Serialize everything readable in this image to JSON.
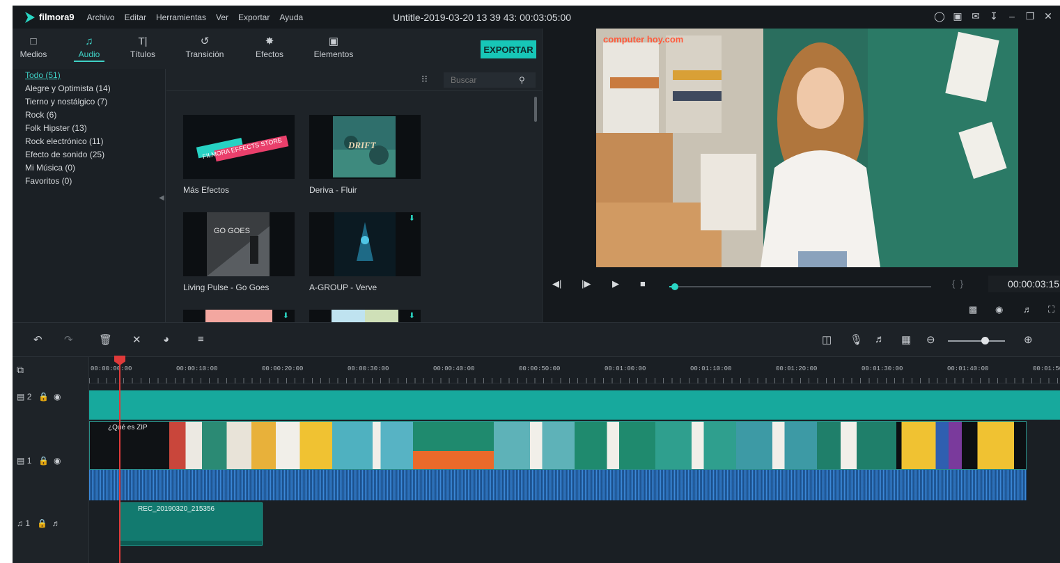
{
  "app": {
    "brand": "filmora9",
    "title": "Untitle-2019-03-20 13 39 43: 00:03:05:00",
    "menu": [
      "Archivo",
      "Editar",
      "Herramientas",
      "Ver",
      "Exportar",
      "Ayuda"
    ],
    "accent": "#17c6b7"
  },
  "tabs": [
    {
      "label": "Medios",
      "icon": "folder-icon"
    },
    {
      "label": "Audio",
      "icon": "music-note-icon",
      "active": true
    },
    {
      "label": "Títulos",
      "icon": "text-title-icon"
    },
    {
      "label": "Transición",
      "icon": "transition-icon"
    },
    {
      "label": "Efectos",
      "icon": "effects-icon"
    },
    {
      "label": "Elementos",
      "icon": "image-elements-icon"
    }
  ],
  "export_label": "EXPORTAR",
  "categories": [
    "Todo (51)",
    "Alegre y Optimista (14)",
    "Tierno y nostálgico (7)",
    "Rock (6)",
    "Folk Hipster (13)",
    "Rock electrónico (11)",
    "Efecto de sonido (25)",
    "Mi Música (0)",
    "Favoritos (0)"
  ],
  "search": {
    "placeholder": "Buscar"
  },
  "library_items": [
    {
      "caption": "Más Efectos",
      "thumb_text": "FILMORA EFFECTS STORE"
    },
    {
      "caption": "Deriva - Fluir",
      "thumb_text": "DRIFT"
    },
    {
      "caption": "Living Pulse - Go Goes",
      "thumb_text": "GO GOES"
    },
    {
      "caption": "A-GROUP - Verve",
      "thumb_text": ""
    },
    {
      "caption": "",
      "thumb_text": ""
    },
    {
      "caption": "",
      "thumb_text": ""
    }
  ],
  "preview": {
    "timecode": "00:00:03:15",
    "progress": 0.02,
    "watermark": "computer hoy.com"
  },
  "timeline": {
    "ruler": [
      "00:00:00:00",
      "00:00:10:00",
      "00:00:20:00",
      "00:00:30:00",
      "00:00:40:00",
      "00:00:50:00",
      "00:01:00:00",
      "00:01:10:00",
      "00:01:20:00",
      "00:01:30:00",
      "00:01:40:00",
      "00:01:50"
    ],
    "tracks": [
      {
        "label": "2",
        "type": "video"
      },
      {
        "label": "1",
        "type": "video"
      },
      {
        "label": "1",
        "type": "audio"
      }
    ],
    "video_clip_title": "¿Qué es ZIP",
    "audio_clip_title": "REC_20190320_215356",
    "zoom_level": 0.65
  }
}
